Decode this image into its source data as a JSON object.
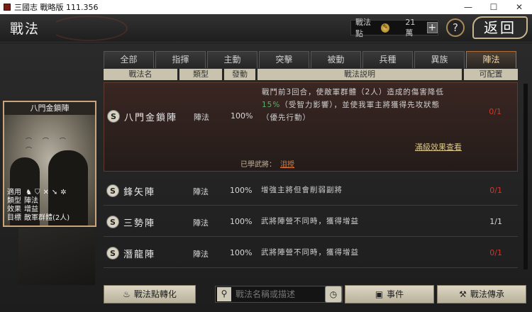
{
  "window": {
    "title": "三國志 戰略版 111.356",
    "minimize": "—",
    "maximize": "☐",
    "close": "✕"
  },
  "header": {
    "title": "戰法",
    "points_label": "戰法點",
    "points_value": "21萬",
    "plus": "+",
    "help": "?",
    "back": "返回"
  },
  "tabs": [
    "全部",
    "指揮",
    "主動",
    "突擊",
    "被動",
    "兵種",
    "異族",
    "陣法"
  ],
  "active_tab": "陣法",
  "columns": {
    "name": "戰法名",
    "type": "類型",
    "rate": "發動",
    "desc": "戰法説明",
    "alloc": "可配置"
  },
  "card": {
    "title": "八門金鎖陣",
    "info": [
      {
        "key": "適用",
        "value": ""
      },
      {
        "key": "類型",
        "value": "陣法"
      },
      {
        "key": "效果",
        "value": "增益"
      },
      {
        "key": "目標",
        "value": "敵軍群體(2人)"
      }
    ]
  },
  "rows": [
    {
      "grade": "S",
      "name": "八門金鎖陣",
      "type": "陣法",
      "rate": "100%",
      "desc_line1": "戰鬥前3回合，使敵軍群體（2人）造成的傷害降低",
      "desc_pct": "15%",
      "desc_line2a": "（受智力影響），並使我軍主將獲得先攻狀態",
      "desc_line3": "（優先行動）",
      "alloc": "0/1",
      "full_effect": "滿級效果查看",
      "learned_label": "已學武將：",
      "learned_general": "沮授"
    },
    {
      "grade": "S",
      "name": "鋒矢陣",
      "type": "陣法",
      "rate": "100%",
      "desc": "增強主將但會削弱副將",
      "alloc": "0/1"
    },
    {
      "grade": "S",
      "name": "三勢陣",
      "type": "陣法",
      "rate": "100%",
      "desc": "武將陣營不同時，獲得增益",
      "alloc": "1/1"
    },
    {
      "grade": "S",
      "name": "潛龍陣",
      "type": "陣法",
      "rate": "100%",
      "desc": "武將陣營不同時，獲得增益",
      "alloc": "0/1"
    }
  ],
  "footer": {
    "convert": "戰法點轉化",
    "search_placeholder": "戰法名稱或描述",
    "events": "事件",
    "inherit": "戰法傳承"
  }
}
